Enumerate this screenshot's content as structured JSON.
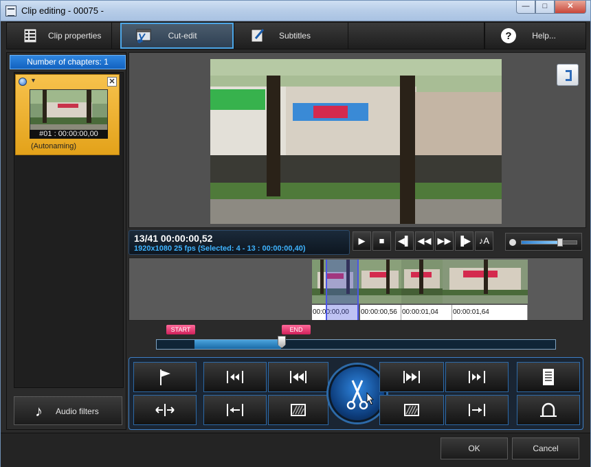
{
  "window": {
    "title": "Clip editing - 00075 -",
    "minimize": "—",
    "maximize": "□",
    "close": "✕"
  },
  "tabs": [
    {
      "label": "Clip properties",
      "icon": "clip-properties-icon"
    },
    {
      "label": "Cut-edit",
      "icon": "cut-edit-icon",
      "active": true
    },
    {
      "label": "Subtitles",
      "icon": "subtitles-icon"
    },
    {
      "label": "Help...",
      "icon": "help-icon"
    }
  ],
  "chapters": {
    "header": "Number of chapters: 1",
    "items": [
      {
        "timecode": "#01 : 00:00:00,00",
        "name": "(Autonaming)"
      }
    ]
  },
  "audio_filters": {
    "label": "Audio filters",
    "icon": "music-note-icon"
  },
  "info": {
    "position": "13/41  00:00:00,52",
    "details": "1920x1080 25  fps  (Selected: 4 - 13 : 00:00:00,40)"
  },
  "transport": [
    "play-icon",
    "stop-icon",
    "prev-frame-icon",
    "rewind-icon",
    "fast-forward-icon",
    "next-frame-icon",
    "audio-track-icon"
  ],
  "volume": {
    "level": 0.7
  },
  "timeline": {
    "frames": [
      {
        "label": "00:00:00,00"
      },
      {
        "label": "00:00:00,56"
      },
      {
        "label": "00:00:01,04"
      },
      {
        "label": "00:00:01,64"
      }
    ]
  },
  "range": {
    "start_label": "START",
    "end_label": "END"
  },
  "colors": {
    "accent": "#3f80c6",
    "chapter": "#f0b33a",
    "info_text": "#3fb4ff",
    "marker": "#e03a70"
  },
  "footer": {
    "ok": "OK",
    "cancel": "Cancel"
  }
}
